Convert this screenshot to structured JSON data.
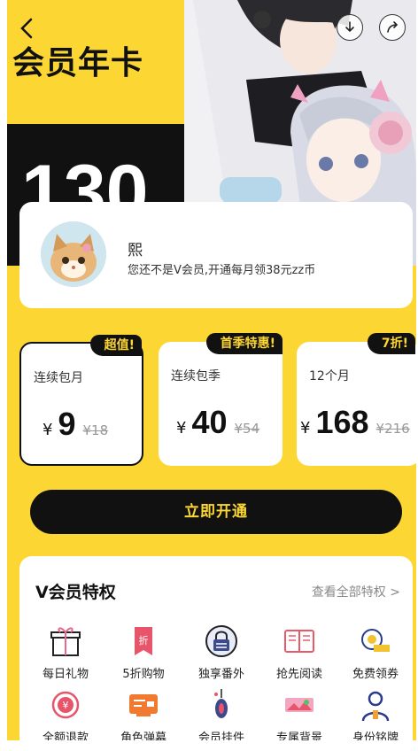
{
  "hero": {
    "title": "会员年卡",
    "big_number": "130"
  },
  "profile": {
    "name": "熙",
    "subtitle": "您还不是V会员,开通每月领38元zz币"
  },
  "plans": [
    {
      "badge": "超值!",
      "name": "连续包月",
      "currency": "¥",
      "price": "9",
      "original": "¥18",
      "selected": true
    },
    {
      "badge": "首季特惠!",
      "name": "连续包季",
      "currency": "¥",
      "price": "40",
      "original": "¥54",
      "selected": false
    },
    {
      "badge": "7折!",
      "name": "12个月",
      "currency": "¥",
      "price": "168",
      "original": "¥216",
      "selected": false
    }
  ],
  "cta": {
    "label": "立即开通"
  },
  "perks": {
    "title": "V会员特权",
    "more_label": "查看全部特权 >",
    "items": [
      {
        "label": "每日礼物",
        "icon": "gift-icon"
      },
      {
        "label": "5折购物",
        "icon": "discount-tag-icon"
      },
      {
        "label": "独享番外",
        "icon": "lock-icon"
      },
      {
        "label": "抢先阅读",
        "icon": "book-icon"
      },
      {
        "label": "免费领券",
        "icon": "coupon-icon"
      },
      {
        "label": "全额退款",
        "icon": "refund-icon"
      },
      {
        "label": "角色弹幕",
        "icon": "danmaku-icon"
      },
      {
        "label": "会员挂件",
        "icon": "pendant-icon"
      },
      {
        "label": "专属背景",
        "icon": "background-icon"
      },
      {
        "label": "身份铭牌",
        "icon": "nameplate-icon"
      }
    ]
  },
  "colors": {
    "accent": "#fcd633",
    "dark": "#111111"
  }
}
